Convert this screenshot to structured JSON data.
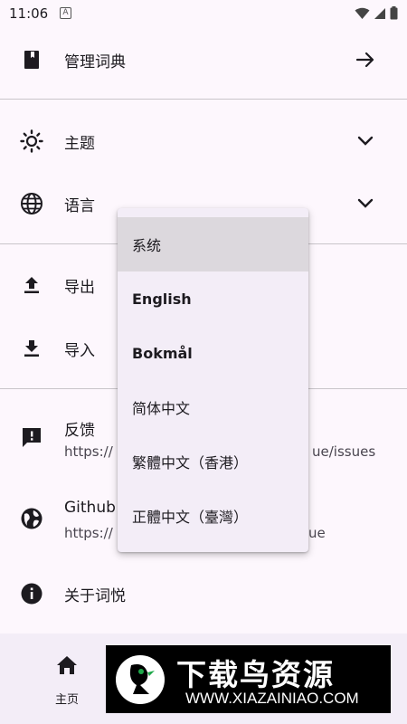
{
  "status_bar": {
    "time": "11:06",
    "notification_glyph": "A"
  },
  "settings": {
    "manage_dict": "管理词典",
    "theme": "主题",
    "language": "语言",
    "export": "导出",
    "import": "导入",
    "feedback": {
      "title": "反馈",
      "subtitle": "https://",
      "subtitle_tail": "ue/issues"
    },
    "github": {
      "title": "Github",
      "subtitle": "https://",
      "subtitle_tail": "ue"
    },
    "about": "关于词悦"
  },
  "language_menu": {
    "options": [
      "系统",
      "English",
      "Bokmål",
      "简体中文",
      "繁體中文（香港）",
      "正體中文（臺灣）"
    ],
    "selected_index": 0
  },
  "bottom_nav": {
    "home_label": "主页"
  },
  "watermark": {
    "title": "下载鸟资源",
    "url": "WWW.XIAZAINIAO.COM"
  },
  "icons": [
    "book-icon",
    "arrow-right-icon",
    "sun-icon",
    "chevron-down-icon",
    "globe-icon",
    "upload-icon",
    "download-icon",
    "feedback-icon",
    "earth-icon",
    "info-icon",
    "home-icon"
  ]
}
